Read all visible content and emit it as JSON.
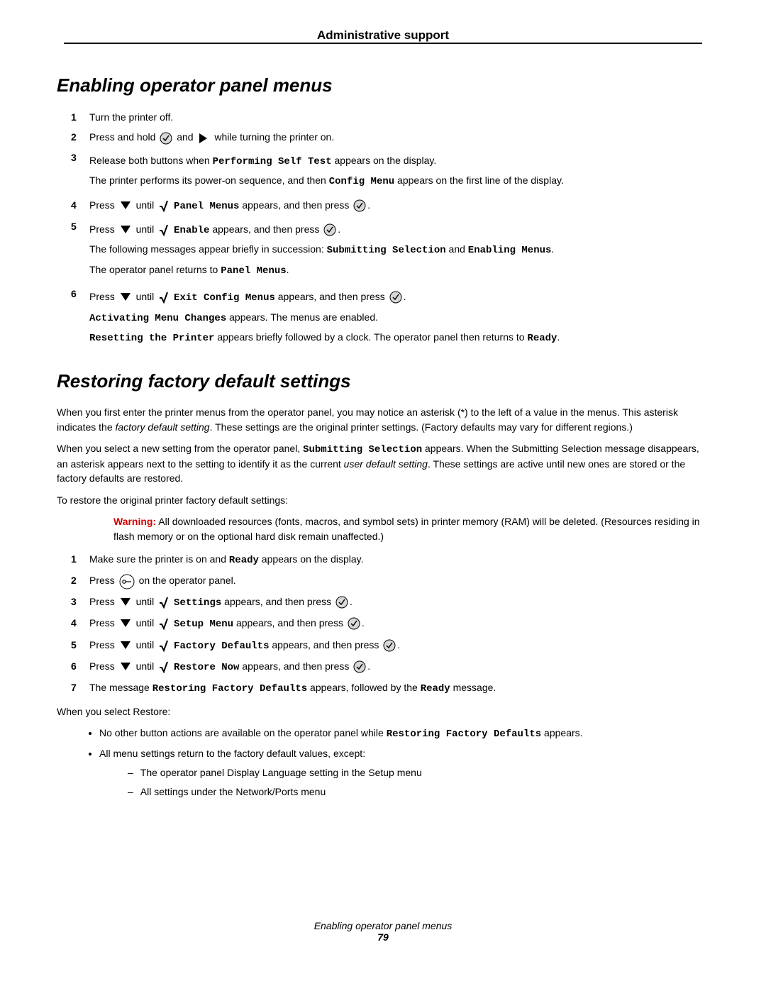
{
  "header": "Administrative support",
  "h1a": "Enabling operator panel menus",
  "stepsA": {
    "s1": "Turn the printer off.",
    "s2a": "Press and hold ",
    "s2b": " and ",
    "s2c": " while turning the printer on.",
    "s3a": "Release both buttons when ",
    "s3mono": "Performing Self Test",
    "s3b": " appears on the display.",
    "s3p2a": "The printer performs its power-on sequence, and then ",
    "s3p2mono": "Config Menu",
    "s3p2b": " appears on the first line of the display.",
    "s4a": "Press ",
    "s4b": " until ",
    "s4mono": "Panel Menus",
    "s4c": " appears, and then press ",
    "s5a": "Press ",
    "s5b": " until ",
    "s5mono": "Enable",
    "s5c": " appears, and then press ",
    "s5p2a": "The following messages appear briefly in succession: ",
    "s5p2mono1": "Submitting Selection",
    "s5p2mid": " and ",
    "s5p2mono2": "Enabling Menus",
    "s5p3a": "The operator panel returns to ",
    "s5p3mono": "Panel Menus",
    "s6a": "Press ",
    "s6b": " until ",
    "s6mono": "Exit Config Menus",
    "s6c": " appears, and then press ",
    "s6p2mono": "Activating Menu Changes",
    "s6p2b": " appears. The menus are enabled.",
    "s6p3mono": "Resetting the Printer",
    "s6p3b": " appears briefly followed by a clock. The operator panel then returns to ",
    "s6p3mono2": "Ready"
  },
  "h1b": "Restoring factory default settings",
  "paraB1a": "When you first enter the printer menus from the operator panel, you may notice an asterisk (*) to the left of a value in the menus. This asterisk indicates the ",
  "paraB1i": "factory default setting",
  "paraB1b": ". These settings are the original printer settings. (Factory defaults may vary for different regions.)",
  "paraB2a": "When you select a new setting from the operator panel, ",
  "paraB2mono": "Submitting Selection",
  "paraB2b": " appears. When the Submitting Selection message disappears, an asterisk appears next to the setting to identify it as the current ",
  "paraB2i": "user default setting",
  "paraB2c": ". These settings are active until new ones are stored or the factory defaults are restored.",
  "paraB3": "To restore the original printer factory default settings:",
  "warnLabel": "Warning:",
  "warnText": " All downloaded resources (fonts, macros, and symbol sets) in printer memory (RAM) will be deleted. (Resources residing in flash memory or on the optional hard disk remain unaffected.)",
  "stepsB": {
    "s1a": "Make sure the printer is on and ",
    "s1mono": "Ready",
    "s1b": " appears on the display.",
    "s2a": "Press ",
    "s2b": " on the operator panel.",
    "s3a": "Press ",
    "s3b": " until ",
    "s3mono": "Settings",
    "s3c": " appears, and then press ",
    "s4a": "Press ",
    "s4b": " until ",
    "s4mono": "Setup Menu",
    "s4c": " appears, and then press ",
    "s5a": "Press ",
    "s5b": " until ",
    "s5mono": "Factory Defaults",
    "s5c": " appears, and then press ",
    "s6a": "Press ",
    "s6b": " until ",
    "s6mono": "Restore Now",
    "s6c": " appears, and then press ",
    "s7a": "The message ",
    "s7mono1": "Restoring Factory Defaults",
    "s7b": " appears, followed by the ",
    "s7mono2": "Ready",
    "s7c": " message."
  },
  "paraB4": "When you select Restore:",
  "bullets": {
    "b1a": "No other button actions are available on the operator panel while ",
    "b1mono": "Restoring Factory Defaults",
    "b1b": " appears.",
    "b2": "All menu settings return to the factory default values, except:",
    "b2s1": "The operator panel Display Language setting in the Setup menu",
    "b2s2": "All settings under the Network/Ports menu"
  },
  "footer": {
    "title": "Enabling operator panel menus",
    "page": "79"
  }
}
